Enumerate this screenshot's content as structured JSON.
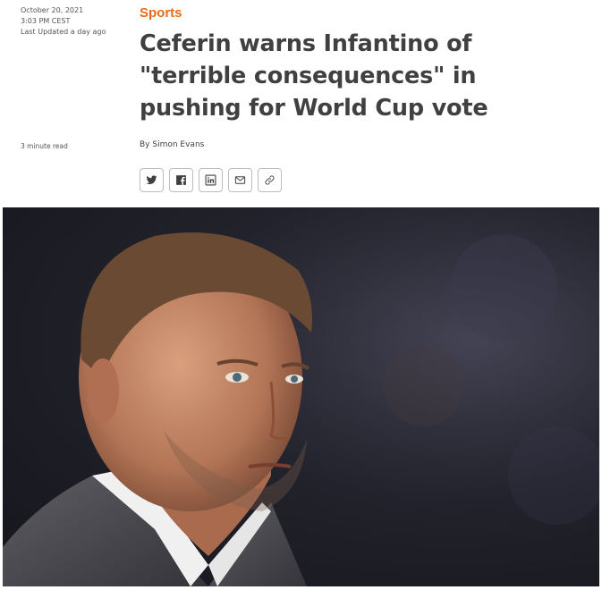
{
  "meta": {
    "date": "October 20, 2021",
    "time": "3:03 PM CEST",
    "updated": "Last Updated a day ago",
    "read_time": "3 minute read"
  },
  "article": {
    "category": "Sports",
    "headline_lines": [
      "Ceferin warns Infantino of",
      "\"terrible consequences\" in",
      "pushing for World Cup vote"
    ],
    "byline": "By Simon Evans"
  },
  "share": [
    {
      "icon": "twitter-icon"
    },
    {
      "icon": "facebook-icon"
    },
    {
      "icon": "linkedin-icon"
    },
    {
      "icon": "email-icon"
    },
    {
      "icon": "link-icon"
    }
  ],
  "colors": {
    "accent": "#eb6a13",
    "text": "#404040"
  }
}
